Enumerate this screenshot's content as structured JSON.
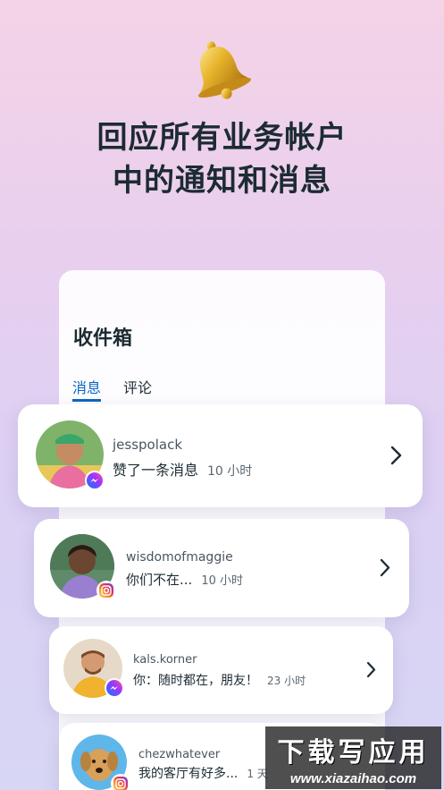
{
  "headline": {
    "line1": "回应所有业务帐户",
    "line2": "中的通知和消息"
  },
  "inbox": {
    "title": "收件箱",
    "tabs": [
      {
        "label": "消息",
        "active": true
      },
      {
        "label": "评论",
        "active": false
      }
    ]
  },
  "conversations": [
    {
      "username": "jesspolack",
      "message": "赞了一条消息",
      "time": "10 小时",
      "platform": "messenger-icon"
    },
    {
      "username": "wisdomofmaggie",
      "message": "你们不在...",
      "time": "10 小时",
      "platform": "instagram-icon"
    },
    {
      "username": "kals.korner",
      "message": "你：随时都在，朋友！",
      "time": "23 小时",
      "platform": "messenger-icon"
    },
    {
      "username": "chezwhatever",
      "message": "我的客厅有好多...",
      "time": "1 天",
      "platform": "instagram-icon"
    }
  ],
  "watermark": {
    "title": "下载写应用",
    "url": "www.xiazaihao.com"
  },
  "colors": {
    "accent": "#0a66c2",
    "text": "#1c2b33"
  }
}
